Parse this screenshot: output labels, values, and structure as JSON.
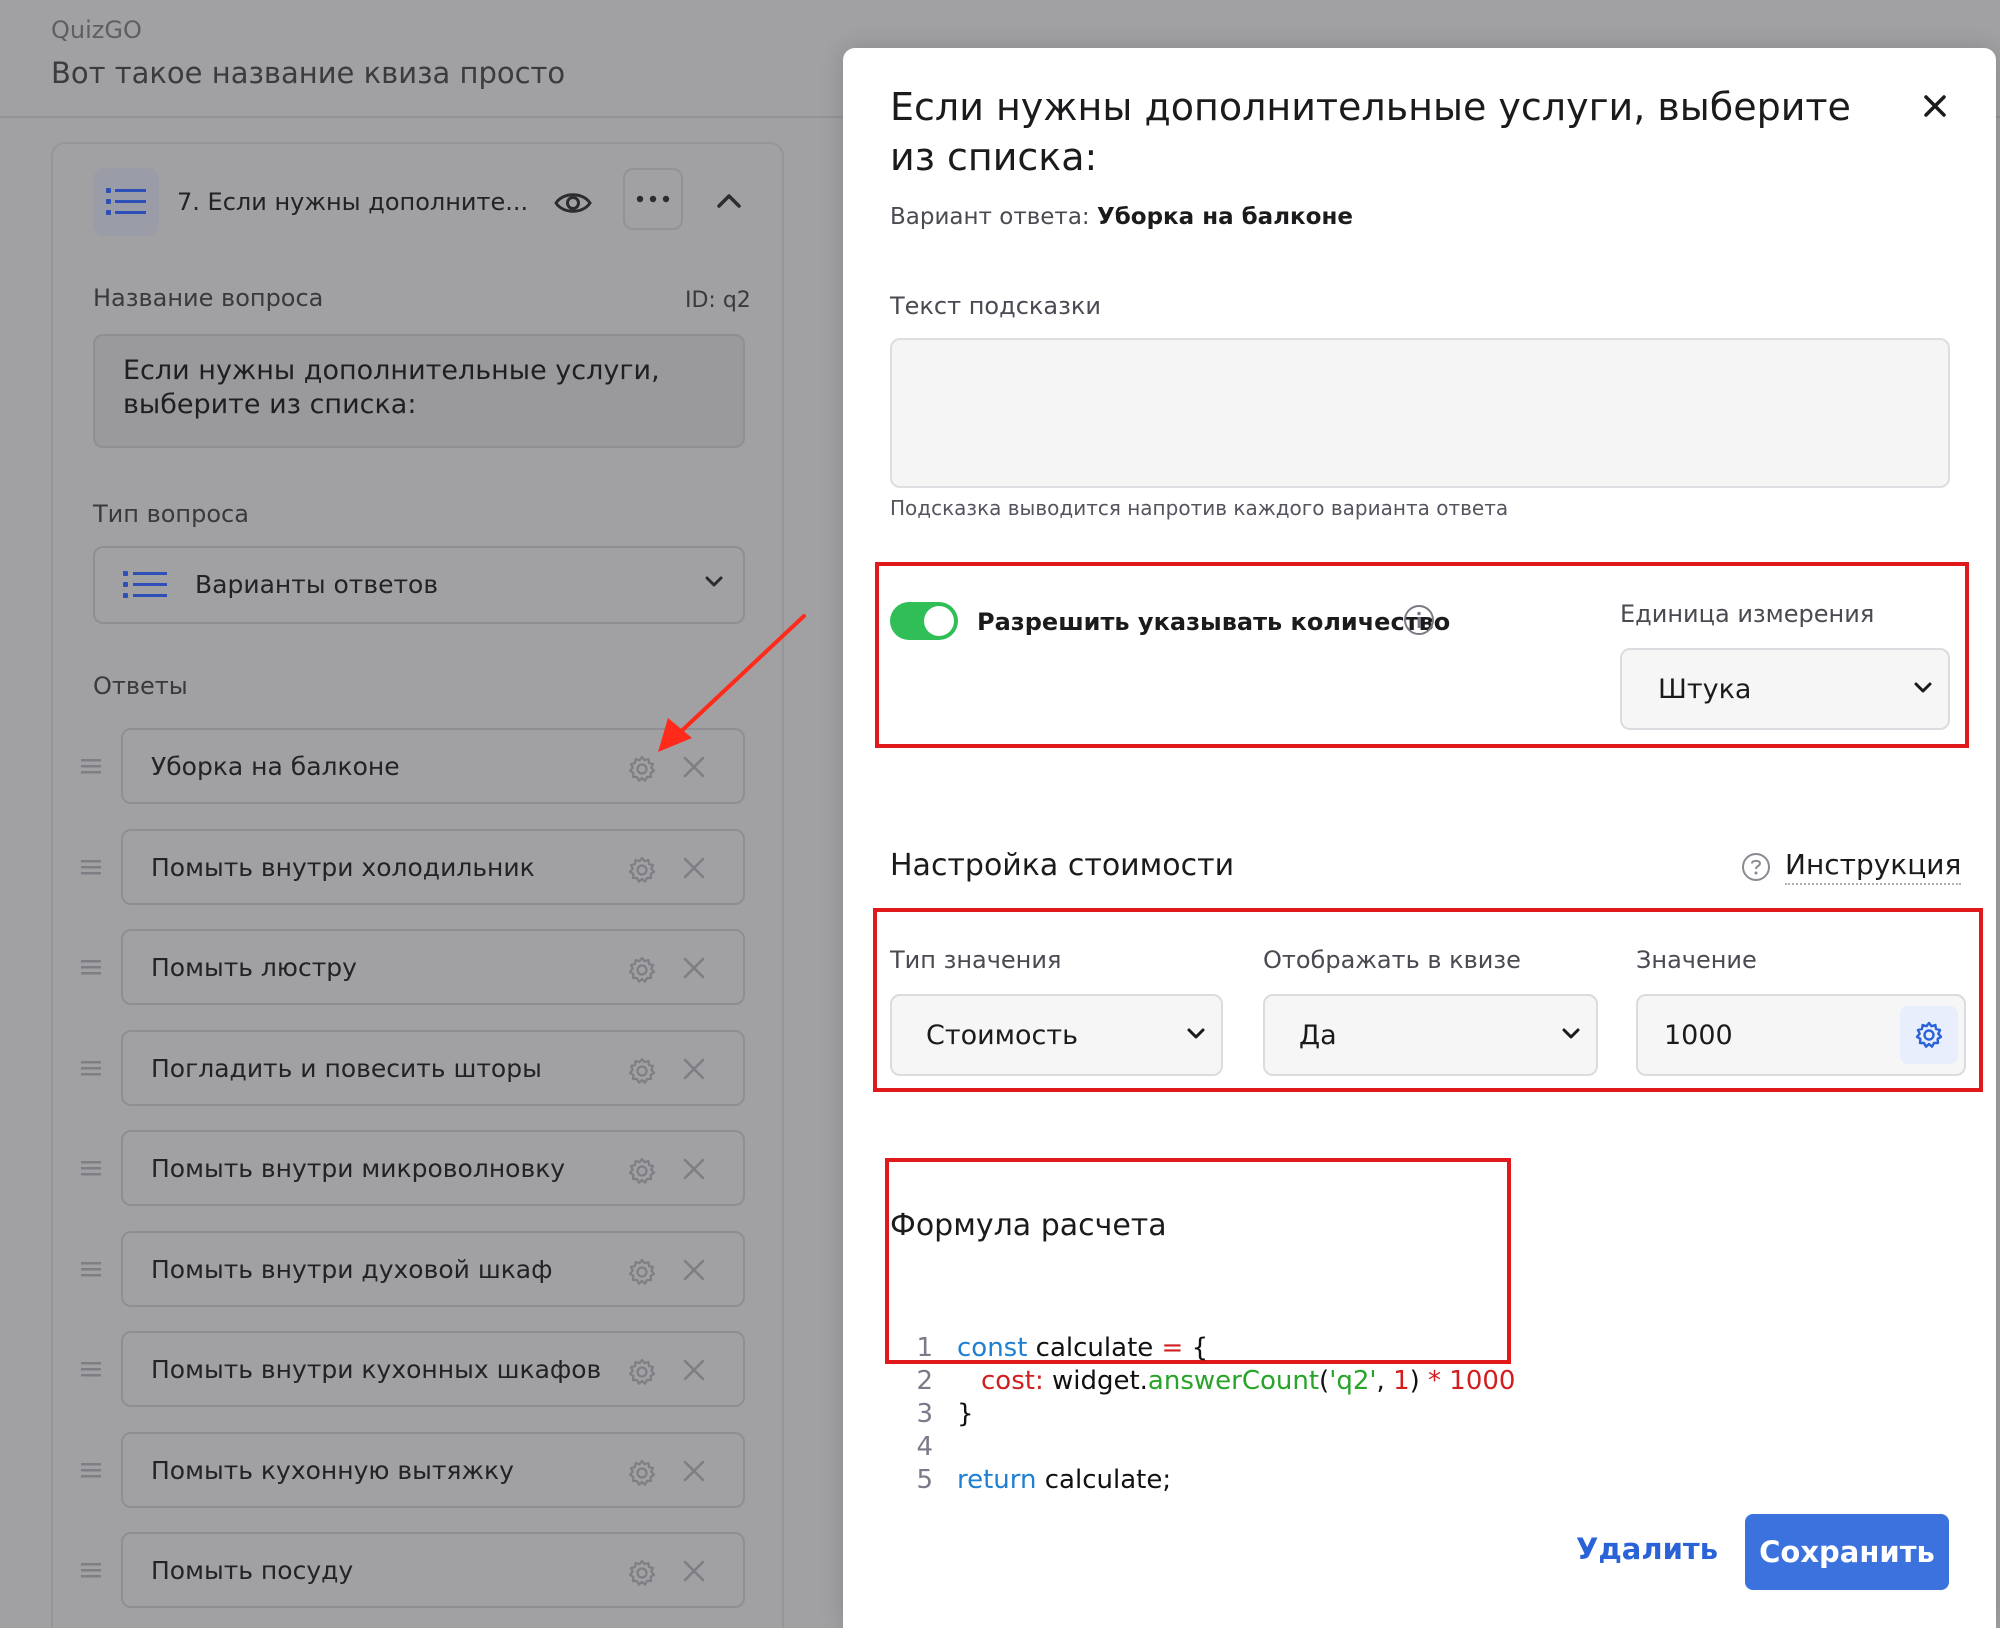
{
  "app": {
    "name": "QuizGO",
    "quiz_title": "Вот такое название квиза просто"
  },
  "question_card": {
    "title": "7. Если нужны дополните...",
    "name_label": "Название вопроса",
    "id_label": "ID: q2",
    "name_value": "Если нужны дополнительные услуги, выберите из списка:",
    "type_label": "Тип вопроса",
    "type_value": "Варианты ответов",
    "answers_label": "Ответы",
    "answers": [
      "Уборка на балконе",
      "Помыть внутри холодильник",
      "Помыть люстру",
      "Погладить и повесить шторы",
      "Помыть внутри микроволновку",
      "Помыть внутри духовой шкаф",
      "Помыть внутри кухонных шкафов",
      "Помыть кухонную вытяжку",
      "Помыть посуду"
    ]
  },
  "modal": {
    "title": "Если нужны дополнительные услуги, выберите из списка:",
    "variant_prefix": "Вариант ответа:",
    "variant_value": "Уборка на балконе",
    "hint_label": "Текст подсказки",
    "hint_value": "",
    "hint_help": "Подсказка выводится напротив каждого варианта ответа",
    "allow_quantity_label": "Разрешить указывать количество",
    "allow_quantity_on": true,
    "unit_label": "Единица измерения",
    "unit_value": "Штука",
    "cost_settings_title": "Настройка стоимости",
    "instruction_label": "Инструкция",
    "value_type_label": "Тип значения",
    "value_type_value": "Стоимость",
    "show_in_quiz_label": "Отображать в квизе",
    "show_in_quiz_value": "Да",
    "value_label": "Значение",
    "value_value": "1000",
    "formula_title": "Формула расчета",
    "code_lines": {
      "n1": "1",
      "n2": "2",
      "n3": "3",
      "n4": "4",
      "n5": "5",
      "l1_kw": "const",
      "l1_rest": " calculate ",
      "l1_op": "=",
      "l1_brace": " {",
      "l2_prop": "cost:",
      "l2_obj": " widget.",
      "l2_fn": "answerCount",
      "l2_open": "(",
      "l2_str": "'q2'",
      "l2_comma": ", ",
      "l2_num": "1",
      "l2_close": ")",
      "l2_mul": " * 1000",
      "l3": "}",
      "l5_kw": "return",
      "l5_rest": " calculate;"
    },
    "delete_label": "Удалить",
    "save_label": "Сохранить"
  },
  "colors": {
    "accent": "#3b72dd",
    "toggle_on": "#2fbf56",
    "highlight_box": "#e01a1a",
    "overlay": "#a1a1a4"
  }
}
